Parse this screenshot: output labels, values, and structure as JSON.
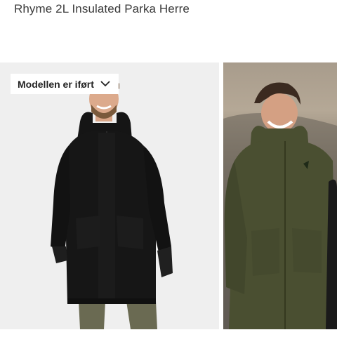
{
  "product": {
    "title": "Rhyme 2L Insulated Parka Herre"
  },
  "gallery": {
    "model_dropdown_label": "Modellen er iført",
    "dropdown_icon": "chevron-down-icon",
    "images": [
      {
        "subject": "model-black-parka",
        "jacket_color": "#141414",
        "background": "#efefef"
      },
      {
        "subject": "model-olive-parka-outdoor",
        "jacket_color": "#4a4f31",
        "background": "#8f8576"
      }
    ]
  }
}
